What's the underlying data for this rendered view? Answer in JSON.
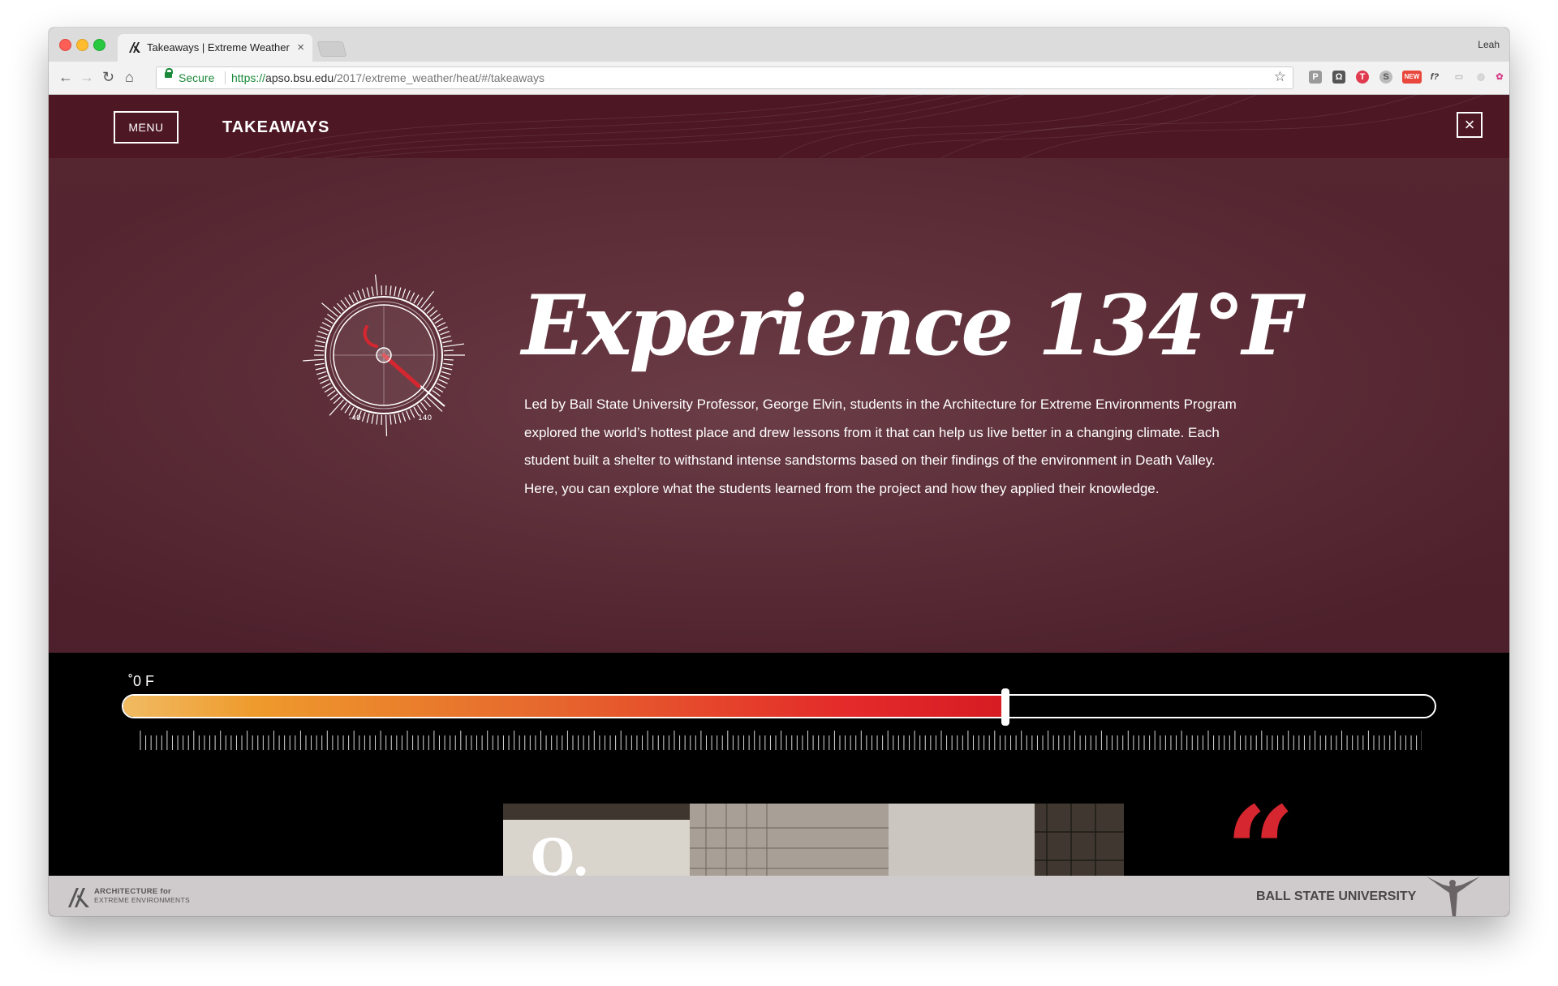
{
  "browser": {
    "tab_title": "Takeaways | Extreme Weather",
    "tab_close": "×",
    "profile_name": "Leah",
    "nav_back": "←",
    "nav_forward": "→",
    "nav_reload": "↻",
    "nav_home": "⌂",
    "secure_label": "Secure",
    "url_scheme": "https://",
    "url_host": "apso.bsu.edu",
    "url_path": "/2017/extreme_weather/heat/#/takeaways",
    "bookmark_star": "☆",
    "more_menu": "⋮",
    "extensions": [
      "P",
      "Ω",
      "T",
      "S",
      "NEW",
      "f?",
      "▭",
      "◎",
      "✿"
    ]
  },
  "header": {
    "menu_label": "MENU",
    "page_title": "TAKEAWAYS",
    "close_glyph": "×"
  },
  "hero": {
    "heading": "Experience 134°F",
    "body": "Led by Ball State University Professor, George Elvin, students in the Architecture for Extreme Environments Program explored the world’s hottest place and drew lessons from it that can help us live better in a changing climate. Each student built a shelter to withstand intense sandstorms based on their findings of the environment in Death Valley. Here, you can explore what the students learned from the project and how they applied their knowledge.",
    "gauge": {
      "min_label": "-40",
      "max_label": "140"
    }
  },
  "slider": {
    "value_label": "˚0 F",
    "fill_fraction": 0.672
  },
  "cards": {
    "quiz_letter": "Q.",
    "quote_glyph": "“"
  },
  "footer": {
    "logo_line1": "ARCHITECTURE for",
    "logo_line2": "EXTREME ENVIRONMENTS",
    "university": "BALL STATE UNIVERSITY"
  },
  "colors": {
    "header_bg": "#4d1724",
    "accent_red": "#d6262f",
    "secure_green": "#1a8a3a"
  }
}
